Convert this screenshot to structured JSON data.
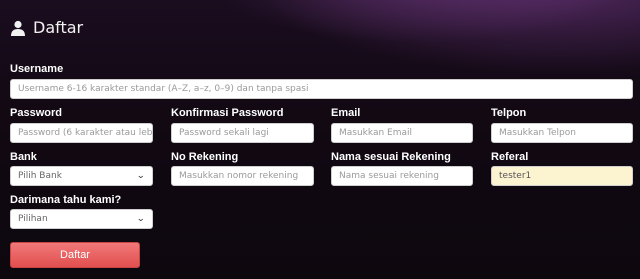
{
  "header": {
    "title": "Daftar",
    "icon": "user-icon"
  },
  "username": {
    "label": "Username",
    "placeholder": "Username 6-16 karakter standar (A–Z, a–z, 0–9) dan tanpa spasi"
  },
  "password": {
    "label": "Password",
    "placeholder": "Password (6 karakter atau lebih)"
  },
  "confirm_password": {
    "label": "Konfirmasi Password",
    "placeholder": "Password sekali lagi"
  },
  "email": {
    "label": "Email",
    "placeholder": "Masukkan Email"
  },
  "phone": {
    "label": "Telpon",
    "placeholder": "Masukkan Telpon"
  },
  "bank": {
    "label": "Bank",
    "selected": "Pilih Bank"
  },
  "account_number": {
    "label": "No Rekening",
    "placeholder": "Masukkan nomor rekening"
  },
  "account_name": {
    "label": "Nama sesuai Rekening",
    "placeholder": "Nama sesuai rekening"
  },
  "referral": {
    "label": "Referal",
    "value": "tester1"
  },
  "source": {
    "label": "Darimana tahu kami?",
    "selected": "Pilihan"
  },
  "submit": {
    "label": "Daftar"
  },
  "colors": {
    "submit_bg": "#e55a5a",
    "referral_bg": "#fcf3d1",
    "background": "#120913"
  }
}
